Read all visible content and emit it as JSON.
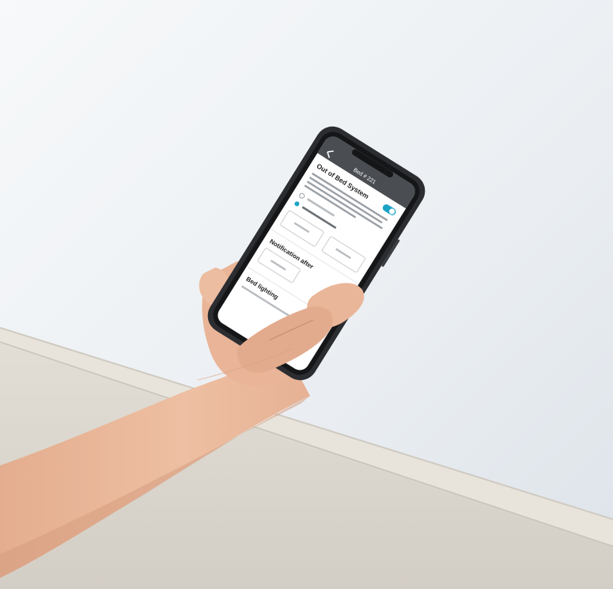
{
  "scene": {
    "colors": {
      "wall_light": "#f4f6f8",
      "wall_shade": "#dfe5ea",
      "floor": "#dcd8d0",
      "baseboard": "#e6e2da",
      "skin": "#e9b79a",
      "skin_shadow": "#cf9378",
      "phone_case": "#2b2d31",
      "screen": "#ffffff",
      "app_header": "#4a4d52",
      "accent": "#1aa3c4"
    },
    "icons": [
      "back-arrow-icon",
      "toggle-icon",
      "radio-icon"
    ]
  },
  "screen": {
    "header_title": "Bed # 221",
    "section_title": "Out of Bed System",
    "notification_title": "Notification after",
    "lighting_title": "Bed lighting"
  }
}
